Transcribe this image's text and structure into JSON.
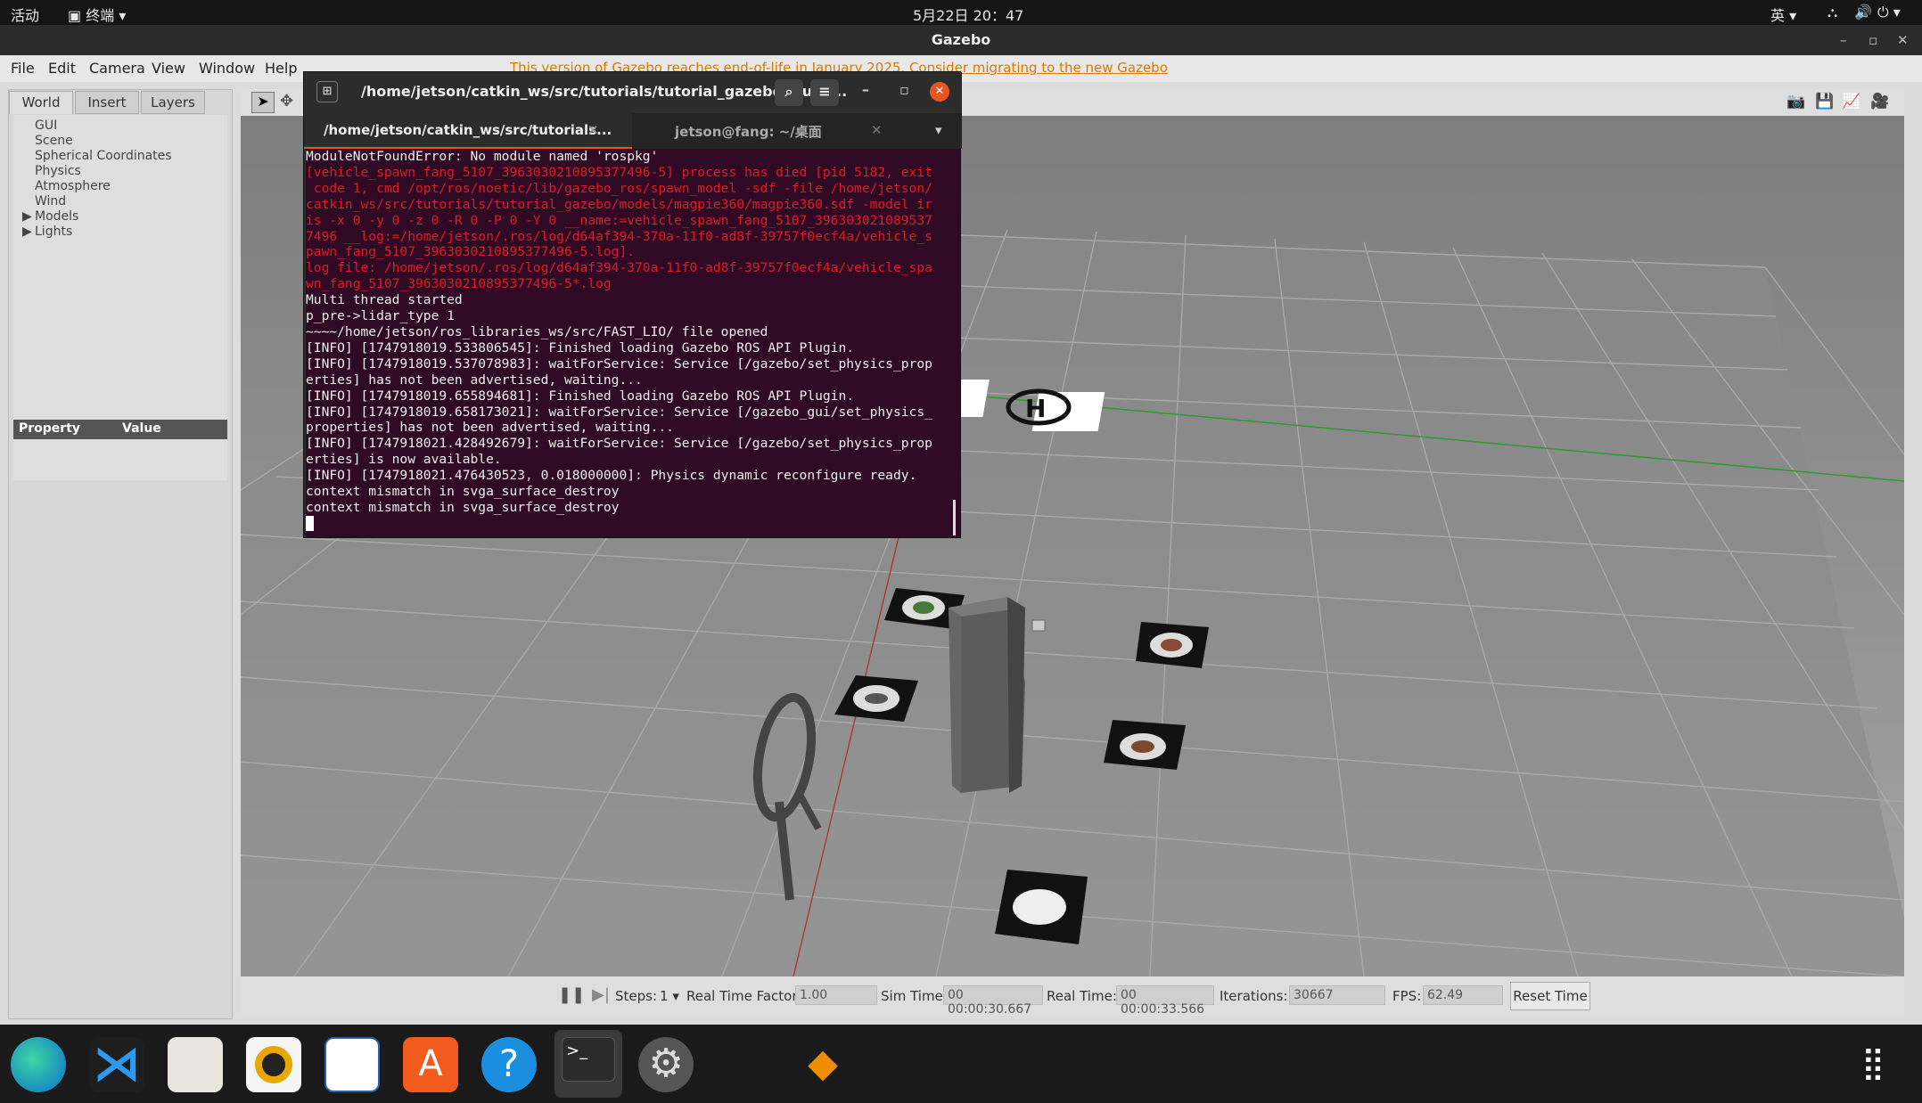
{
  "topbar": {
    "activities": "活动",
    "terminal_menu": "终端",
    "datetime": "5月22日 20：47",
    "ime": "英"
  },
  "window": {
    "title": "Gazebo"
  },
  "menu": {
    "file": "File",
    "edit": "Edit",
    "camera": "Camera",
    "view": "View",
    "window": "Window",
    "help": "Help",
    "eol_notice": "This version of Gazebo reaches end-of-life in January 2025. Consider migrating to the new Gazebo"
  },
  "left_tabs": {
    "world": "World",
    "insert": "Insert",
    "layers": "Layers"
  },
  "tree": [
    "GUI",
    "Scene",
    "Spherical Coordinates",
    "Physics",
    "Atmosphere",
    "Wind",
    "Models",
    "Lights"
  ],
  "props": {
    "property": "Property",
    "value": "Value"
  },
  "bottom": {
    "steps_label": "Steps:",
    "steps_value": "1",
    "rtf_label": "Real Time Factor:",
    "rtf_value": "1.00",
    "sim_label": "Sim Time:",
    "sim_value": "00 00:00:30.667",
    "real_label": "Real Time:",
    "real_value": "00 00:00:33.566",
    "iter_label": "Iterations:",
    "iter_value": "30667",
    "fps_label": "FPS:",
    "fps_value": "62.49",
    "reset": "Reset Time"
  },
  "terminal": {
    "title": "/home/jetson/catkin_ws/src/tutorials/tutorial_gazebo/launc...",
    "tab1": "/home/jetson/catkin_ws/src/tutorials...",
    "tab2": "jetson@fang: ~/桌面",
    "lines": [
      "ModuleNotFoundError: No module named 'rospkg'",
      "[vehicle_spawn_fang_5107_3963030210895377496-5] process has died [pid 5182, exit",
      " code 1, cmd /opt/ros/noetic/lib/gazebo_ros/spawn_model -sdf -file /home/jetson/",
      "catkin_ws/src/tutorials/tutorial_gazebo/models/magpie360/magpie360.sdf -model ir",
      "is -x 0 -y 0 -z 0 -R 0 -P 0 -Y 0 __name:=vehicle_spawn_fang_5107_396303021089537",
      "7496 __log:=/home/jetson/.ros/log/d64af394-370a-11f0-ad8f-39757f0ecf4a/vehicle_s",
      "pawn_fang_5107_3963030210895377496-5.log].",
      "log file: /home/jetson/.ros/log/d64af394-370a-11f0-ad8f-39757f0ecf4a/vehicle_spa",
      "wn_fang_5107_3963030210895377496-5*.log",
      "Multi thread started",
      "p_pre->lidar_type 1",
      "~~~~/home/jetson/ros_libraries_ws/src/FAST_LIO/ file opened",
      "[INFO] [1747918019.533806545]: Finished loading Gazebo ROS API Plugin.",
      "[INFO] [1747918019.537078983]: waitForService: Service [/gazebo/set_physics_prop",
      "erties] has not been advertised, waiting...",
      "[INFO] [1747918019.655894681]: Finished loading Gazebo ROS API Plugin.",
      "[INFO] [1747918019.658173021]: waitForService: Service [/gazebo_gui/set_physics_",
      "properties] has not been advertised, waiting...",
      "[INFO] [1747918021.428492679]: waitForService: Service [/gazebo/set_physics_prop",
      "erties] is now available.",
      "[INFO] [1747918021.476430523, 0.018000000]: Physics dynamic reconfigure ready.",
      "context mismatch in svga_surface_destroy",
      "context mismatch in svga_surface_destroy"
    ]
  },
  "dock": [
    "edge-icon",
    "vscode-icon",
    "files-icon",
    "rhythmbox-icon",
    "writer-icon",
    "appstore-icon",
    "help-icon",
    "terminal-icon",
    "settings-icon",
    "app-icon"
  ]
}
